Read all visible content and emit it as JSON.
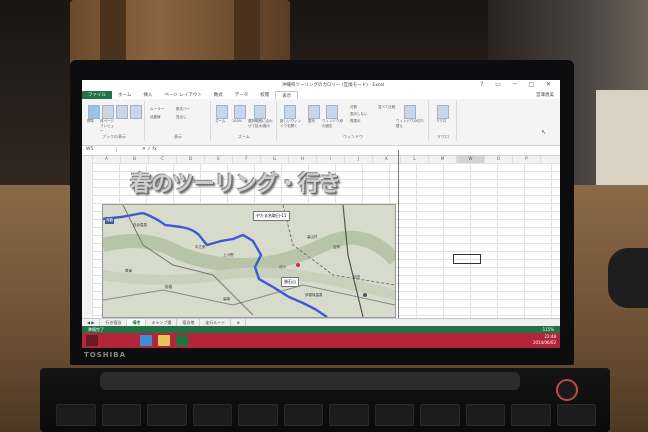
{
  "excel": {
    "window_title": "沖縄県ツーリングのカロリー (互換モード) - Excel",
    "signin": "宮澤恵美",
    "tabs": [
      {
        "label": "ファイル"
      },
      {
        "label": "ホーム"
      },
      {
        "label": "挿入"
      },
      {
        "label": "ページ レイアウト"
      },
      {
        "label": "数式"
      },
      {
        "label": "データ"
      },
      {
        "label": "校閲"
      },
      {
        "label": "表示"
      }
    ],
    "active_tab_index": 7,
    "ribbon_groups": [
      {
        "label": "ブックの表示"
      },
      {
        "label": "表示"
      },
      {
        "label": "ズーム"
      },
      {
        "label": "ウィンドウ"
      },
      {
        "label": "マクロ"
      }
    ],
    "ribbon_buttons": {
      "normal": "標準",
      "pagebreak": "改ページ プレビュー",
      "pagelayout": "ページ レイアウト",
      "custom": "ユーザー設定のビュー",
      "ruler": "ルーラー",
      "formula_bar": "数式バー",
      "gridlines": "目盛線",
      "headings": "見出し",
      "zoom": "ズーム",
      "zoom100": "100%",
      "zoom_sel": "選択範囲に合わせて拡大/縮小",
      "new_window": "新しいウィンドウを開く",
      "arrange": "整列",
      "freeze": "ウィンドウ枠の固定",
      "split": "分割",
      "hide": "表示しない",
      "unhide": "再表示",
      "side": "並べて比較",
      "switch": "ウィンドウの切り替え",
      "macro": "マクロ"
    },
    "namebox": "W5",
    "columns": [
      "A",
      "B",
      "C",
      "D",
      "E",
      "F",
      "G",
      "H",
      "I",
      "J",
      "K",
      "L",
      "M",
      "W",
      "O",
      "P"
    ],
    "selected_column": "W",
    "wordart_title": "春のツーリング・行き",
    "map": {
      "callout_main": "やたる名取日-11",
      "callout_small": "香石山",
      "place_labels": [
        "真鶴",
        "白倉温泉",
        "中之条",
        "高山村",
        "吉岡",
        "上小野",
        "渋川",
        "沼田",
        "伊香保温泉",
        "草津",
        "前橋",
        "高崎"
      ]
    },
    "sheet_tabs": [
      "行き宿泊",
      "帰宅",
      "キャンプ場",
      "宿泊地",
      "走行ルート"
    ],
    "active_sheet_index": 1,
    "status_ready": "準備完了",
    "zoom_level": "115%"
  },
  "taskbar": {
    "time": "22:48",
    "date": "2014/06/02",
    "apps": [
      {
        "icon": "ie-icon"
      },
      {
        "icon": "folder-icon"
      },
      {
        "icon": "excel-icon"
      }
    ]
  },
  "laptop": {
    "brand": "TOSHIBA"
  }
}
